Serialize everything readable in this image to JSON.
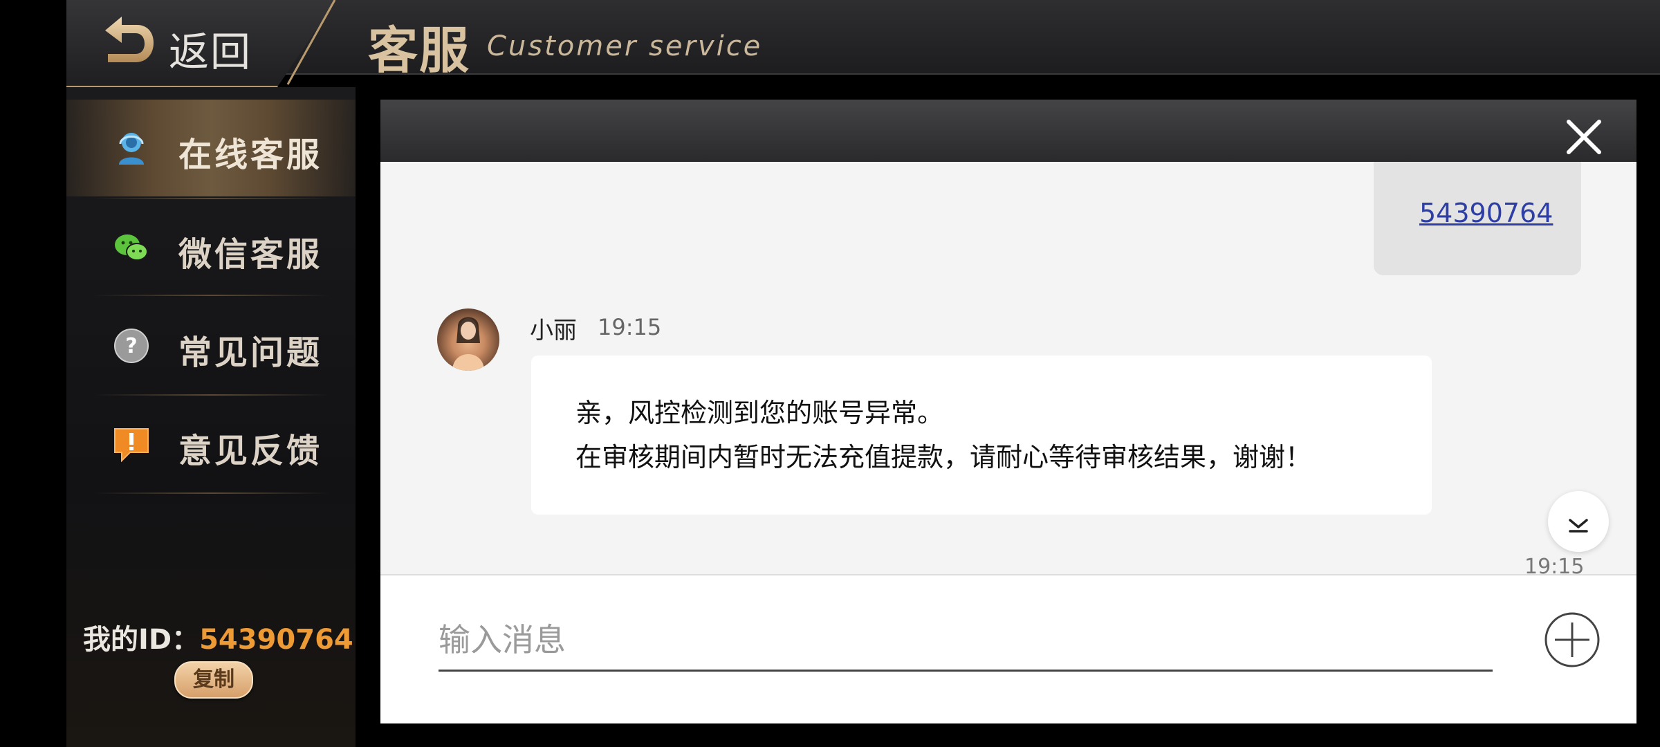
{
  "header": {
    "back_label": "返回",
    "title": "客服",
    "subtitle": "Customer service"
  },
  "sidebar": {
    "items": [
      {
        "label": "在线客服",
        "icon": "online-service-icon",
        "active": true
      },
      {
        "label": "微信客服",
        "icon": "wechat-icon",
        "active": false
      },
      {
        "label": "常见问题",
        "icon": "question-icon",
        "active": false
      },
      {
        "label": "意见反馈",
        "icon": "feedback-icon",
        "active": false
      }
    ],
    "id_label": "我的ID：",
    "id_value": "54390764",
    "copy_label": "复制"
  },
  "chat": {
    "self_message": "54390764",
    "sender_name": "小丽",
    "sender_time": "19:15",
    "message_line1": "亲，风控检测到您的账号异常。",
    "message_line2": "在审核期间内暂时无法充值提款，请耐心等待审核结果，谢谢！",
    "bottom_time": "19:15"
  },
  "input": {
    "placeholder": "输入消息",
    "value": ""
  },
  "colors": {
    "accent_gold": "#d8c2a0",
    "id_orange": "#ee9a35",
    "link_blue": "#2d3ea6",
    "chat_bg": "#f4f4f4"
  }
}
